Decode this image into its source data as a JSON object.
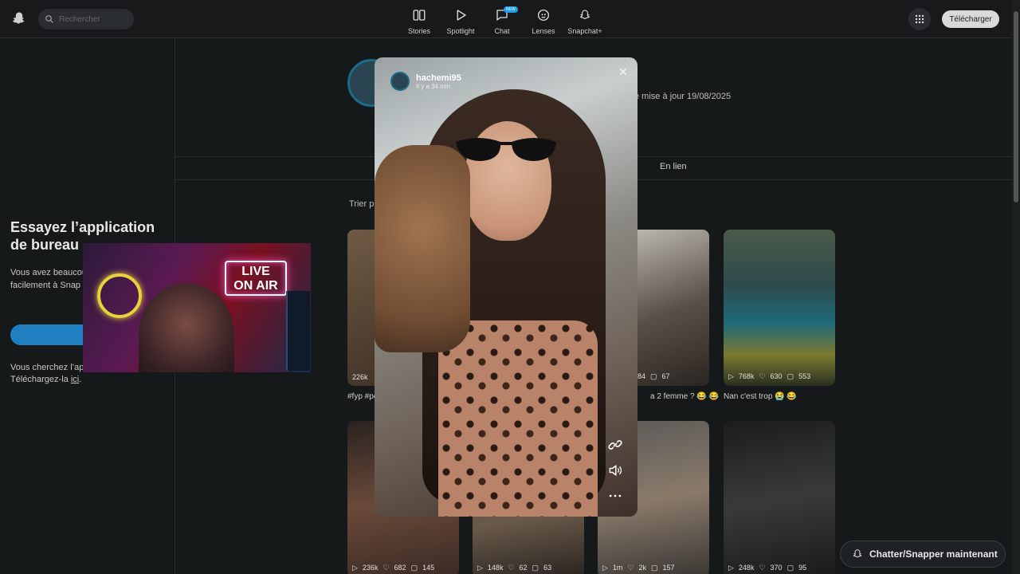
{
  "topbar": {
    "search_placeholder": "Rechercher",
    "nav": [
      {
        "label": "Stories",
        "icon": "stories-icon"
      },
      {
        "label": "Spotlight",
        "icon": "spotlight-icon"
      },
      {
        "label": "Chat",
        "icon": "chat-icon",
        "badge": "NEW"
      },
      {
        "label": "Lenses",
        "icon": "lenses-icon"
      },
      {
        "label": "Snapchat+",
        "icon": "snapchat-plus-icon"
      }
    ],
    "download_label": "Télécharger"
  },
  "left_panel": {
    "title": "Essayez l’application de bureau",
    "body": "Vous avez beaucoup ouverts ? Accédez facilement à Snap l’application.",
    "button_label": "C",
    "mobile_text": "Vous cherchez l’ap mobile&nbsp;? Téléchargez-la",
    "mobile_link": "ici",
    "mobile_suffix": "."
  },
  "profile": {
    "updated": "e mise à jour 19/08/2025",
    "tab_label": "En lien",
    "sort_label": "Trier p"
  },
  "cards": [
    {
      "views": "226k",
      "likes": "",
      "comments": "",
      "caption": "#fyp #pc"
    },
    {
      "views": "",
      "likes": "84",
      "comments": "67",
      "caption": "a 2 femme ? 😂 😂"
    },
    {
      "views": "768k",
      "likes": "630",
      "comments": "553",
      "caption": "Nan c'est trop 😭 😂"
    },
    {
      "views": "236k",
      "likes": "682",
      "comments": "145",
      "caption": ""
    },
    {
      "views": "148k",
      "likes": "62",
      "comments": "63",
      "caption": ""
    },
    {
      "views": "1m",
      "likes": "2k",
      "comments": "157",
      "caption": ""
    },
    {
      "views": "248k",
      "likes": "370",
      "comments": "95",
      "caption": ""
    }
  ],
  "story": {
    "username": "hachemi95",
    "time": "Il y a 34 min"
  },
  "chat_pill_label": "Chatter/Snapper maintenant",
  "colors": {
    "background": "#16191a",
    "accent": "#1f7fc0"
  }
}
